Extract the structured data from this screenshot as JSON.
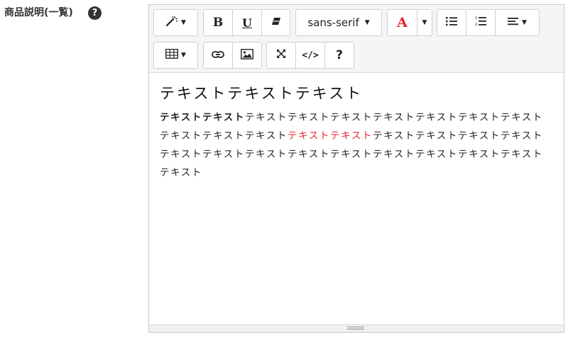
{
  "field": {
    "label": "商品説明(一覧)",
    "help": "?"
  },
  "toolbar": {
    "style_icon": "magic-wand",
    "bold": "B",
    "underline": "U",
    "eraser_icon": "eraser",
    "font_name": "sans-serif",
    "color_letter": "A",
    "color_accent": "#e8232a",
    "ul_icon": "bullet-list",
    "ol_icon": "numbered-list",
    "align_icon": "align-left",
    "table_icon": "table-grid",
    "link_icon": "link",
    "picture_icon": "picture",
    "fullscreen_icon": "expand",
    "codeview": "</>",
    "help": "?"
  },
  "content": {
    "heading": "テキストテキストテキスト",
    "bold_text": "テキストテキスト",
    "text_before_red": "テキストテキストテキストテキストテキストテキストテキストテキストテキストテキスト",
    "red_text": "テキストテキスト",
    "text_after_red": "テキストテキストテキストテキストテキストテキストテキストテキストテキストテキストテキストテキストテキストテキスト"
  }
}
